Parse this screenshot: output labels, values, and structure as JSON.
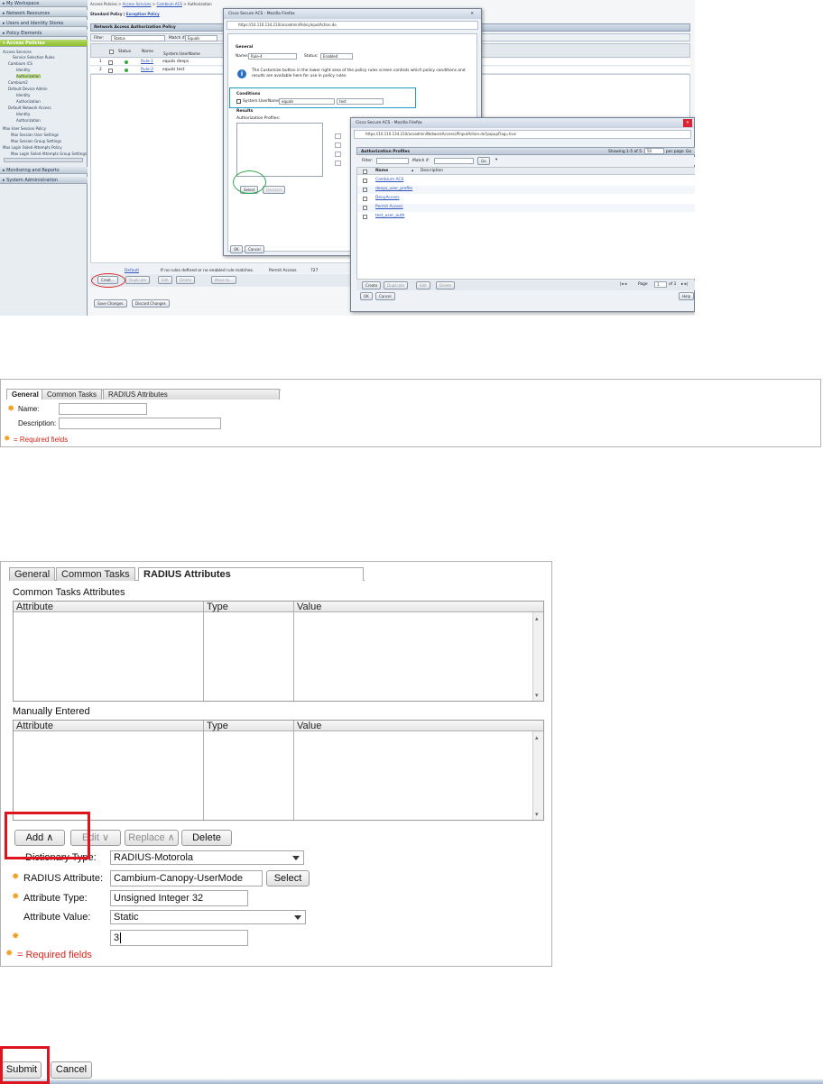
{
  "top": {
    "nav": {
      "items": [
        "My Workspace",
        "Network Resources",
        "Users and Identity Stores",
        "Policy Elements",
        "Access Policies"
      ],
      "subitems": [
        "Access Services",
        "Service Selection Rules",
        "Cambium iCS",
        "Identity",
        "Authorization",
        "Cambium2",
        "Default Device Admin",
        "Identity",
        "Authorization",
        "Default Network Access",
        "Identity",
        "Authorization",
        "Max User Session Policy",
        "Max Session User Settings",
        "Max Session Group Settings",
        "Max Login Failed Attempts Policy",
        "Max Login Failed Attempts Group Settings"
      ],
      "bottom_items": [
        "Monitoring and Reports",
        "System Administration"
      ]
    },
    "crumb": {
      "prefix": "Access Policies >",
      "link1": "Access Services",
      "sep": ">",
      "link2": "Cambium ACS",
      "suffix": "> Authorization"
    },
    "policy_header": {
      "prefix": "Standard Policy |",
      "link": "Exception Policy"
    },
    "table_title": "Network Access Authorization Policy",
    "filter": {
      "label": "Filter:",
      "field": "Status",
      "match": "Match if:",
      "equals": "Equals"
    },
    "grid": {
      "cols": {
        "status": "Status",
        "name": "Name",
        "conditions": "Conditions",
        "sub": "System:UserName"
      },
      "rows": [
        {
          "num": "1",
          "name": "Rule-1",
          "cond": "equals deeps"
        },
        {
          "num": "2",
          "name": "Rule-2",
          "cond": "equals test"
        }
      ]
    },
    "default_row": {
      "name": "Default",
      "text": "If no rules defined or no enabled rule matches.",
      "result": "Permit Access",
      "hits": "727"
    },
    "buttons": {
      "create": "Creat...",
      "duplicate": "Duplicate",
      "edit": "Edit",
      "delete": "Delete",
      "move": "Move to..."
    },
    "bottom_buttons": {
      "save": "Save Changes",
      "discard": "Discard Changes"
    },
    "dialog1": {
      "title": "Cisco Secure ACS - Mozilla Firefox",
      "url": "https://10.110.134.210/acsadmin/PolicyInputAction.do",
      "general": "General",
      "name_label": "Name:",
      "name_value": "Rule-4",
      "status_label": "Status:",
      "status_value": "Enabled",
      "info": "The Customize button in the lower right area of the policy rules screen controls which policy conditions and results are available here for use in policy rules.",
      "conditions": "Conditions",
      "cond_field": "System:UserName:",
      "cond_op": "equals",
      "cond_val": "test",
      "results": "Results",
      "auth_profiles": "Authorization Profiles:",
      "select": "Select",
      "deselect": "Deselect",
      "ok": "OK",
      "cancel": "Cancel"
    },
    "dialog2": {
      "title": "Cisco Secure ACS - Mozilla Firefox",
      "url": "https://10.110.134.210/acsadmin/NetworkAccessLPInputAction.do?popupFlag=true",
      "header": "Authorization Profiles",
      "showing": "Showing 1-5 of 5",
      "per_page_value": "50",
      "per_page": "per page",
      "go": "Go",
      "filter": "Filter:",
      "match": "Match if:",
      "go2": "Go",
      "col_name": "Name",
      "col_desc": "Description",
      "rows": [
        "Cambium ACS",
        "deeps_user_profile",
        "DenyAccess",
        "Permit Access",
        "test_user_auth"
      ],
      "create": "Create",
      "duplicate": "Duplicate",
      "edit": "Edit",
      "delete": "Delete",
      "page": "Page",
      "page_num": "1",
      "page_of": "of 1",
      "ok": "OK",
      "cancel": "Cancel",
      "help": "Help"
    }
  },
  "panel2": {
    "tabs": [
      "General",
      "Common Tasks",
      "RADIUS Attributes"
    ],
    "name_label": "Name:",
    "desc_label": "Description:",
    "required": "= Required fields"
  },
  "panel3": {
    "tabs": [
      "General",
      "Common Tasks",
      "RADIUS Attributes"
    ],
    "common_title": "Common Tasks Attributes",
    "manual_title": "Manually Entered",
    "col_attribute": "Attribute",
    "col_type": "Type",
    "col_value": "Value",
    "buttons": {
      "add": "Add ∧",
      "edit": "Edit ∨",
      "replace": "Replace ∧",
      "delete": "Delete"
    },
    "dict_label": "Dictionary Type:",
    "dict_value": "RADIUS-Motorola",
    "attr_label": "RADIUS Attribute:",
    "attr_value": "Cambium-Canopy-UserMode",
    "select": "Select",
    "type_label": "Attribute Type:",
    "type_value": "Unsigned Integer 32",
    "value_label": "Attribute Value:",
    "value_value": "Static",
    "value_input": "3",
    "required": "= Required fields"
  },
  "bottom": {
    "submit": "Submit",
    "cancel": "Cancel"
  },
  "colors": {
    "accent_green": "#8cbf2b",
    "highlight_red": "#e0141e",
    "required_orange": "#f0a020",
    "highlight_blue": "#1f9bc9"
  }
}
